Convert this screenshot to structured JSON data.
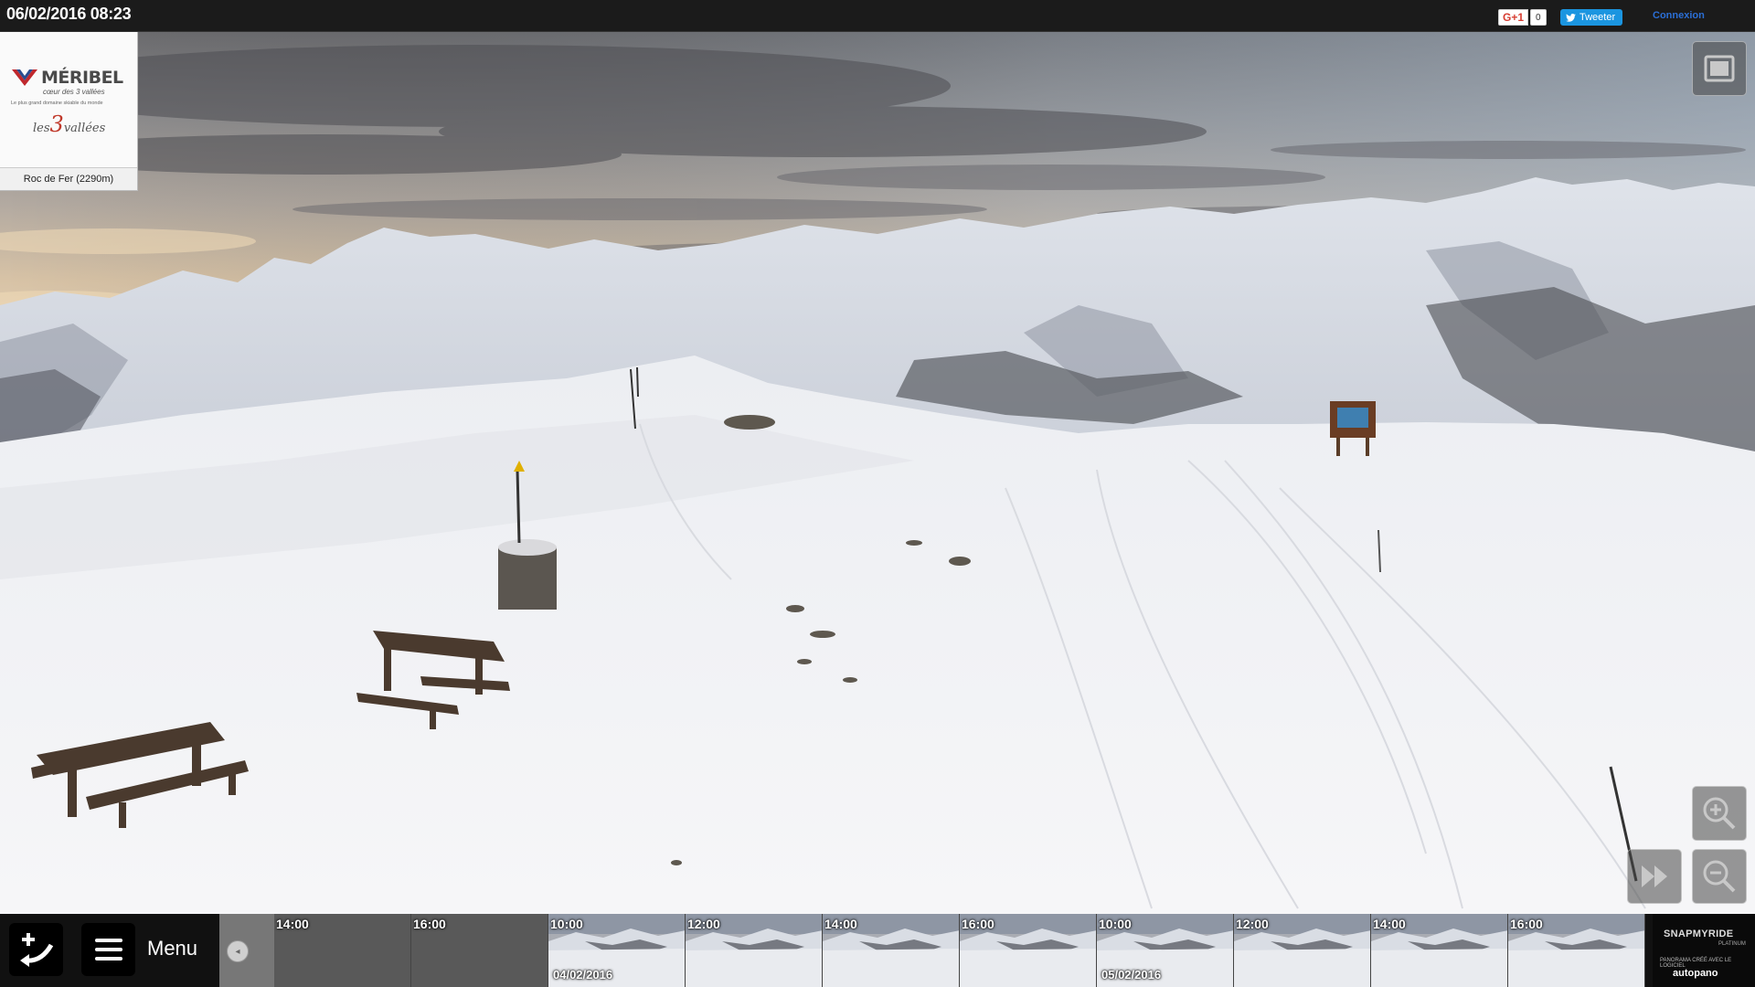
{
  "header": {
    "datetime": "06/02/2016 08:23",
    "gplus_label": "G+1",
    "gplus_count": "0",
    "tweet_label": "Tweeter",
    "login_label": "Connexion"
  },
  "logo": {
    "brand": "MÉRIBEL",
    "subtitle": "cœur des 3 vallées",
    "tagline": "Le plus grand domaine skiable du monde",
    "area_prefix": "les",
    "area_number": "3",
    "area_suffix": "vallées",
    "location": "Roc de Fer (2290m)"
  },
  "controls": {
    "fullscreen_icon": "fullscreen-icon",
    "zoom_in_icon": "zoom-in-icon",
    "zoom_out_icon": "zoom-out-icon",
    "fast_forward_icon": "fast-forward-icon"
  },
  "bottom": {
    "menu_label": "Menu",
    "timeline": [
      {
        "time": "14:00",
        "date": "",
        "style": "dark"
      },
      {
        "time": "16:00",
        "date": "",
        "style": "dark"
      },
      {
        "time": "10:00",
        "date": "04/02/2016",
        "style": "snow"
      },
      {
        "time": "12:00",
        "date": "",
        "style": "snow"
      },
      {
        "time": "14:00",
        "date": "",
        "style": "snow"
      },
      {
        "time": "16:00",
        "date": "",
        "style": "snow"
      },
      {
        "time": "10:00",
        "date": "05/02/2016",
        "style": "snow"
      },
      {
        "time": "12:00",
        "date": "",
        "style": "snow"
      },
      {
        "time": "14:00",
        "date": "",
        "style": "snow"
      },
      {
        "time": "16:00",
        "date": "",
        "style": "snow"
      }
    ],
    "brand_snap": "SNAPMYRIDE",
    "brand_platinum": "PLATINUM",
    "brand_credit": "PANORAMA CRÉÉ AVEC LE LOGICIEL",
    "brand_autopano": "autopano"
  }
}
